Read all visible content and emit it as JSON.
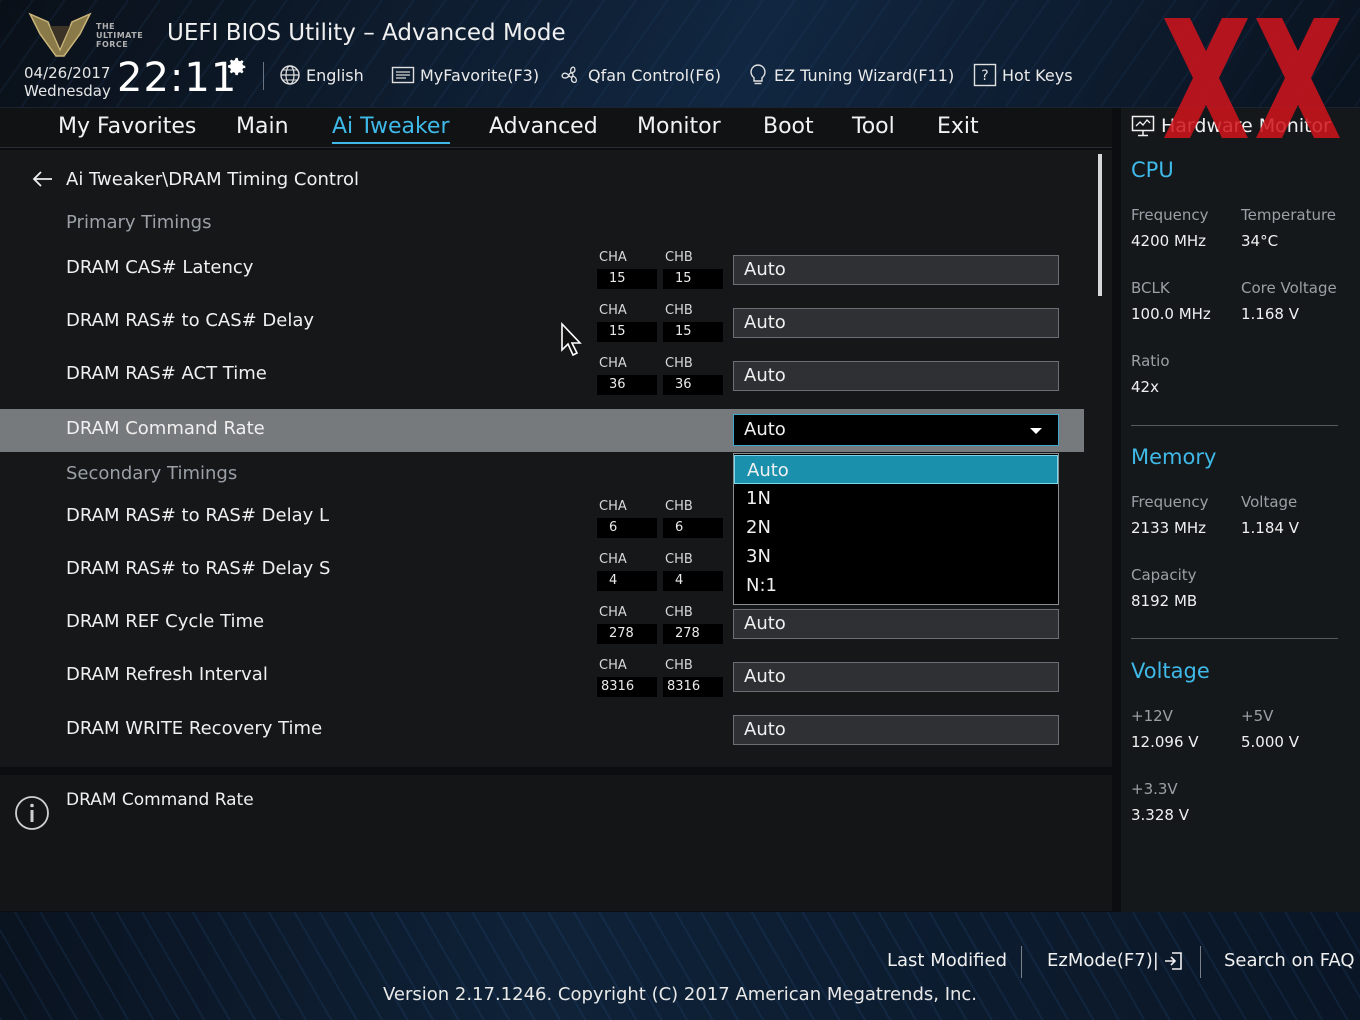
{
  "header": {
    "brand_text": "THE ULTIMATE FORCE",
    "title": "UEFI BIOS Utility – Advanced Mode",
    "date": "04/26/2017",
    "weekday": "Wednesday",
    "time": "22:11",
    "items": {
      "language": "English",
      "my_favorite": "MyFavorite(F3)",
      "qfan": "Qfan Control(F6)",
      "ez_tuning": "EZ Tuning Wizard(F11)",
      "hot_keys": "Hot Keys"
    }
  },
  "menu": {
    "tabs": [
      "My Favorites",
      "Main",
      "Ai Tweaker",
      "Advanced",
      "Monitor",
      "Boot",
      "Tool",
      "Exit"
    ],
    "active": "Ai Tweaker"
  },
  "main": {
    "breadcrumb": "Ai Tweaker\\DRAM Timing Control",
    "primary_label": "Primary Timings",
    "secondary_label": "Secondary Timings",
    "channel_a": "CHA",
    "channel_b": "CHB",
    "rows": [
      {
        "label": "DRAM CAS# Latency",
        "cha": "15",
        "chb": "15",
        "value": "Auto"
      },
      {
        "label": "DRAM RAS# to CAS# Delay",
        "cha": "15",
        "chb": "15",
        "value": "Auto"
      },
      {
        "label": "DRAM RAS# ACT Time",
        "cha": "36",
        "chb": "36",
        "value": "Auto"
      },
      {
        "label": "DRAM Command Rate",
        "value": "Auto"
      },
      {
        "label": "DRAM RAS# to RAS# Delay L",
        "cha": "6",
        "chb": "6"
      },
      {
        "label": "DRAM RAS# to RAS# Delay S",
        "cha": "4",
        "chb": "4"
      },
      {
        "label": "DRAM REF Cycle Time",
        "cha": "278",
        "chb": "278",
        "value": "Auto"
      },
      {
        "label": "DRAM Refresh Interval",
        "cha": "8316",
        "chb": "8316",
        "value": "Auto"
      },
      {
        "label": "DRAM WRITE Recovery Time",
        "value": "Auto"
      }
    ],
    "dropdown_options": [
      "Auto",
      "1N",
      "2N",
      "3N",
      "N:1"
    ],
    "dropdown_selected": "Auto"
  },
  "info": {
    "text": "DRAM Command Rate"
  },
  "hardware_monitor": {
    "title": "Hardware Monitor",
    "cpu": {
      "heading": "CPU",
      "frequency_label": "Frequency",
      "frequency": "4200 MHz",
      "temperature_label": "Temperature",
      "temperature": "34°C",
      "bclk_label": "BCLK",
      "bclk": "100.0 MHz",
      "core_voltage_label": "Core Voltage",
      "core_voltage": "1.168 V",
      "ratio_label": "Ratio",
      "ratio": "42x"
    },
    "memory": {
      "heading": "Memory",
      "frequency_label": "Frequency",
      "frequency": "2133 MHz",
      "voltage_label": "Voltage",
      "voltage": "1.184 V",
      "capacity_label": "Capacity",
      "capacity": "8192 MB"
    },
    "voltage": {
      "heading": "Voltage",
      "v12_label": "+12V",
      "v12": "12.096 V",
      "v5_label": "+5V",
      "v5": "5.000 V",
      "v33_label": "+3.3V",
      "v33": "3.328 V"
    }
  },
  "footer": {
    "last_modified": "Last Modified",
    "ezmode": "EzMode(F7)|",
    "search_faq": "Search on FAQ",
    "copyright": "Version 2.17.1246. Copyright (C) 2017 American Megatrends, Inc."
  },
  "colors": {
    "accent": "#3fb9e8",
    "selected_option": "#1b90ad",
    "highlight_row": "#777a7d",
    "watermark": "#d2141c"
  }
}
